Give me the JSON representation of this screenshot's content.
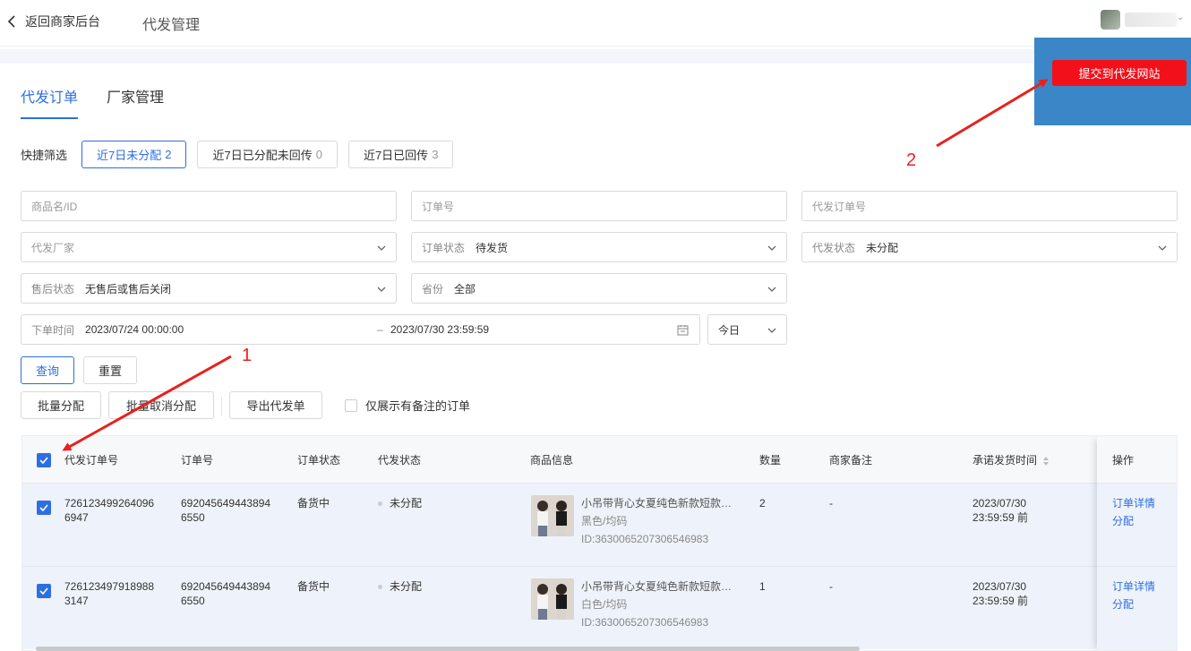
{
  "header": {
    "back_label": "返回商家后台",
    "title": "代发管理"
  },
  "tabs": [
    {
      "label": "代发订单",
      "active": true
    },
    {
      "label": "厂家管理",
      "active": false
    }
  ],
  "quick_filter": {
    "label": "快捷筛选",
    "options": [
      {
        "label": "近7日未分配",
        "count": "2",
        "active": true
      },
      {
        "label": "近7日已分配未回传",
        "count": "0",
        "active": false
      },
      {
        "label": "近7日已回传",
        "count": "3",
        "active": false
      }
    ]
  },
  "filters": {
    "product_placeholder": "商品名/ID",
    "order_no_placeholder": "订单号",
    "proxy_order_no_placeholder": "代发订单号",
    "factory_placeholder": "代发厂家",
    "order_status": {
      "label": "订单状态",
      "value": "待发货"
    },
    "proxy_status": {
      "label": "代发状态",
      "value": "未分配"
    },
    "after_sale": {
      "label": "售后状态",
      "value": "无售后或售后关闭"
    },
    "province": {
      "label": "省份",
      "value": "全部"
    },
    "order_time": {
      "label": "下单时间",
      "start": "2023/07/24 00:00:00",
      "separator": "–",
      "end": "2023/07/30 23:59:59"
    },
    "quick_date": "今日"
  },
  "actions": {
    "query": "查询",
    "reset": "重置",
    "batch_assign": "批量分配",
    "batch_cancel": "批量取消分配",
    "export": "导出代发单",
    "only_notes": "仅展示有备注的订单"
  },
  "table": {
    "columns": [
      "代发订单号",
      "订单号",
      "订单状态",
      "代发状态",
      "商品信息",
      "数量",
      "商家备注",
      "承诺发货时间",
      "操作"
    ],
    "rows": [
      {
        "proxy_no_line1": "726123499264096",
        "proxy_no_line2": "6947",
        "order_no_line1": "692045649443894",
        "order_no_line2": "6550",
        "order_status": "备货中",
        "proxy_status": "未分配",
        "product_title": "小吊带背心女夏纯色新款短款…",
        "product_sku": "黑色/均码",
        "product_id": "ID:3630065207306546983",
        "qty": "2",
        "note": "-",
        "ship_date": "2023/07/30",
        "ship_time": "23:59:59 前",
        "op_detail": "订单详情",
        "op_assign": "分配",
        "checked": true
      },
      {
        "proxy_no_line1": "726123497918988",
        "proxy_no_line2": "3147",
        "order_no_line1": "692045649443894",
        "order_no_line2": "6550",
        "order_status": "备货中",
        "proxy_status": "未分配",
        "product_title": "小吊带背心女夏纯色新款短款…",
        "product_sku": "白色/均码",
        "product_id": "ID:3630065207306546983",
        "qty": "1",
        "note": "-",
        "ship_date": "2023/07/30",
        "ship_time": "23:59:59 前",
        "op_detail": "订单详情",
        "op_assign": "分配",
        "checked": true
      }
    ]
  },
  "overlay": {
    "submit_label": "提交到代发网站"
  },
  "annotations": {
    "first": "1",
    "second": "2"
  },
  "colors": {
    "accent": "#2d6ee3",
    "annotation": "#e8211e",
    "submit": "#f2101a",
    "overlay": "#3b86c6"
  }
}
